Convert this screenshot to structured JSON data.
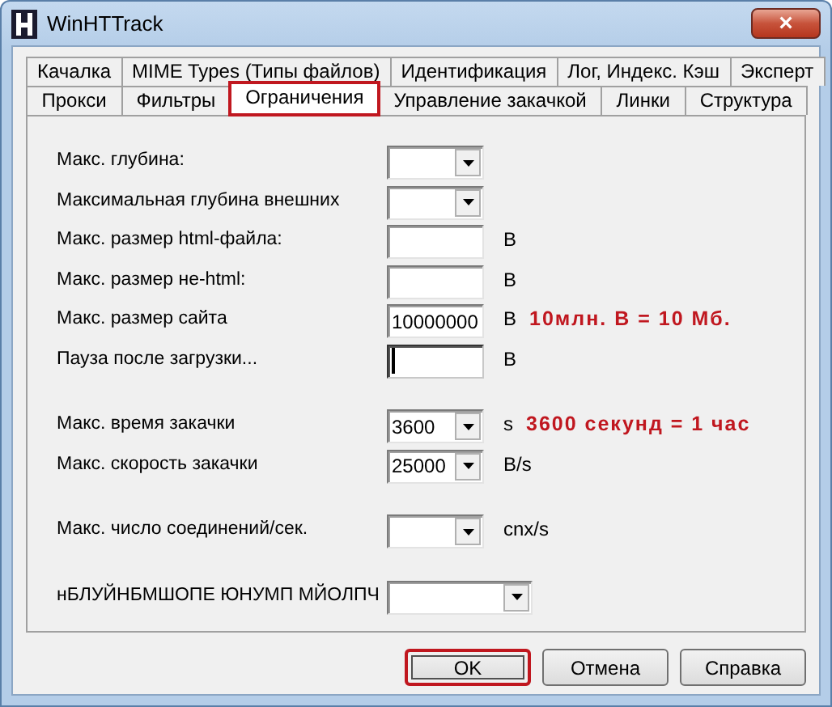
{
  "window": {
    "title": "WinHTTrack",
    "close_label": "×"
  },
  "tab_rows": [
    [
      {
        "label": "Качалка",
        "selected": false,
        "highlighted": false
      },
      {
        "label": "MIME Types (Типы файлов)",
        "selected": false,
        "highlighted": false
      },
      {
        "label": "Идентификация",
        "selected": false,
        "highlighted": false
      },
      {
        "label": "Лог, Индекс. Кэш",
        "selected": false,
        "highlighted": false
      },
      {
        "label": "Эксперт",
        "selected": false,
        "highlighted": false
      }
    ],
    [
      {
        "label": "Прокси",
        "selected": false,
        "highlighted": false
      },
      {
        "label": "Фильтры",
        "selected": false,
        "highlighted": false
      },
      {
        "label": "Ограничения",
        "selected": true,
        "highlighted": true
      },
      {
        "label": "Управление закачкой",
        "selected": false,
        "highlighted": false
      },
      {
        "label": "Линки",
        "selected": false,
        "highlighted": false
      },
      {
        "label": "Структура",
        "selected": false,
        "highlighted": false
      }
    ]
  ],
  "sections": [
    [
      {
        "label": "Макс. глубина:",
        "kind": "dropdown",
        "focused": false
      },
      {
        "label": "Максимальная глубина внешних",
        "kind": "dropdown",
        "focused": false
      },
      {
        "label": "Макс. размер html-файла:",
        "kind": "text",
        "unit": "B",
        "focused": false
      },
      {
        "label": "Макс. размер не-html:",
        "kind": "text",
        "unit": "B",
        "focused": false
      },
      {
        "label": "Макс. размер сайта",
        "kind": "text",
        "value": "10000000",
        "unit": "B",
        "note": "10млн. В = 10 Мб.",
        "focused": false
      },
      {
        "label": "Пауза после загрузки...",
        "kind": "text",
        "unit": "B",
        "focused": true
      }
    ],
    [
      {
        "label": "Макс. время закачки",
        "kind": "dropdown",
        "value": "3600",
        "unit": "s",
        "note": "3600 секунд = 1 час",
        "focused": false
      },
      {
        "label": "Макс. скорость закачки",
        "kind": "dropdown",
        "value": "25000",
        "unit": "B/s",
        "focused": false
      }
    ],
    [
      {
        "label": "Макс. число соединений/сек.",
        "kind": "dropdown",
        "unit": "cnx/s",
        "focused": false
      }
    ],
    [
      {
        "label": "нБЛУЙНБМШОПЕ ЮНУМП МЙОЛПЧ",
        "kind": "wide_dropdown",
        "focused": false
      }
    ]
  ],
  "buttons": [
    {
      "label": "OK",
      "highlighted": true
    },
    {
      "label": "Отмена",
      "highlighted": false
    },
    {
      "label": "Справка",
      "highlighted": false
    }
  ]
}
